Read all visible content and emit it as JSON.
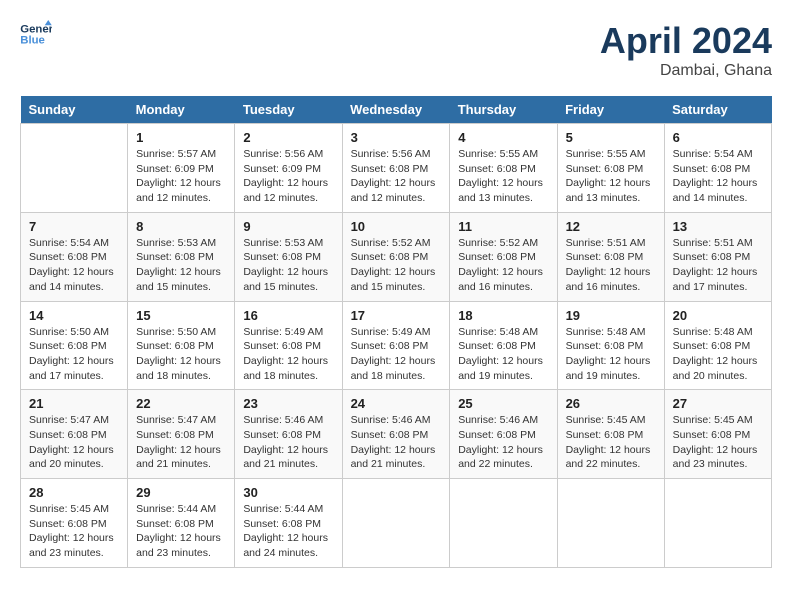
{
  "header": {
    "logo_line1": "General",
    "logo_line2": "Blue",
    "month": "April 2024",
    "location": "Dambai, Ghana"
  },
  "weekdays": [
    "Sunday",
    "Monday",
    "Tuesday",
    "Wednesday",
    "Thursday",
    "Friday",
    "Saturday"
  ],
  "weeks": [
    [
      {
        "day": "",
        "info": ""
      },
      {
        "day": "1",
        "info": "Sunrise: 5:57 AM\nSunset: 6:09 PM\nDaylight: 12 hours\nand 12 minutes."
      },
      {
        "day": "2",
        "info": "Sunrise: 5:56 AM\nSunset: 6:09 PM\nDaylight: 12 hours\nand 12 minutes."
      },
      {
        "day": "3",
        "info": "Sunrise: 5:56 AM\nSunset: 6:08 PM\nDaylight: 12 hours\nand 12 minutes."
      },
      {
        "day": "4",
        "info": "Sunrise: 5:55 AM\nSunset: 6:08 PM\nDaylight: 12 hours\nand 13 minutes."
      },
      {
        "day": "5",
        "info": "Sunrise: 5:55 AM\nSunset: 6:08 PM\nDaylight: 12 hours\nand 13 minutes."
      },
      {
        "day": "6",
        "info": "Sunrise: 5:54 AM\nSunset: 6:08 PM\nDaylight: 12 hours\nand 14 minutes."
      }
    ],
    [
      {
        "day": "7",
        "info": "Sunrise: 5:54 AM\nSunset: 6:08 PM\nDaylight: 12 hours\nand 14 minutes."
      },
      {
        "day": "8",
        "info": "Sunrise: 5:53 AM\nSunset: 6:08 PM\nDaylight: 12 hours\nand 15 minutes."
      },
      {
        "day": "9",
        "info": "Sunrise: 5:53 AM\nSunset: 6:08 PM\nDaylight: 12 hours\nand 15 minutes."
      },
      {
        "day": "10",
        "info": "Sunrise: 5:52 AM\nSunset: 6:08 PM\nDaylight: 12 hours\nand 15 minutes."
      },
      {
        "day": "11",
        "info": "Sunrise: 5:52 AM\nSunset: 6:08 PM\nDaylight: 12 hours\nand 16 minutes."
      },
      {
        "day": "12",
        "info": "Sunrise: 5:51 AM\nSunset: 6:08 PM\nDaylight: 12 hours\nand 16 minutes."
      },
      {
        "day": "13",
        "info": "Sunrise: 5:51 AM\nSunset: 6:08 PM\nDaylight: 12 hours\nand 17 minutes."
      }
    ],
    [
      {
        "day": "14",
        "info": "Sunrise: 5:50 AM\nSunset: 6:08 PM\nDaylight: 12 hours\nand 17 minutes."
      },
      {
        "day": "15",
        "info": "Sunrise: 5:50 AM\nSunset: 6:08 PM\nDaylight: 12 hours\nand 18 minutes."
      },
      {
        "day": "16",
        "info": "Sunrise: 5:49 AM\nSunset: 6:08 PM\nDaylight: 12 hours\nand 18 minutes."
      },
      {
        "day": "17",
        "info": "Sunrise: 5:49 AM\nSunset: 6:08 PM\nDaylight: 12 hours\nand 18 minutes."
      },
      {
        "day": "18",
        "info": "Sunrise: 5:48 AM\nSunset: 6:08 PM\nDaylight: 12 hours\nand 19 minutes."
      },
      {
        "day": "19",
        "info": "Sunrise: 5:48 AM\nSunset: 6:08 PM\nDaylight: 12 hours\nand 19 minutes."
      },
      {
        "day": "20",
        "info": "Sunrise: 5:48 AM\nSunset: 6:08 PM\nDaylight: 12 hours\nand 20 minutes."
      }
    ],
    [
      {
        "day": "21",
        "info": "Sunrise: 5:47 AM\nSunset: 6:08 PM\nDaylight: 12 hours\nand 20 minutes."
      },
      {
        "day": "22",
        "info": "Sunrise: 5:47 AM\nSunset: 6:08 PM\nDaylight: 12 hours\nand 21 minutes."
      },
      {
        "day": "23",
        "info": "Sunrise: 5:46 AM\nSunset: 6:08 PM\nDaylight: 12 hours\nand 21 minutes."
      },
      {
        "day": "24",
        "info": "Sunrise: 5:46 AM\nSunset: 6:08 PM\nDaylight: 12 hours\nand 21 minutes."
      },
      {
        "day": "25",
        "info": "Sunrise: 5:46 AM\nSunset: 6:08 PM\nDaylight: 12 hours\nand 22 minutes."
      },
      {
        "day": "26",
        "info": "Sunrise: 5:45 AM\nSunset: 6:08 PM\nDaylight: 12 hours\nand 22 minutes."
      },
      {
        "day": "27",
        "info": "Sunrise: 5:45 AM\nSunset: 6:08 PM\nDaylight: 12 hours\nand 23 minutes."
      }
    ],
    [
      {
        "day": "28",
        "info": "Sunrise: 5:45 AM\nSunset: 6:08 PM\nDaylight: 12 hours\nand 23 minutes."
      },
      {
        "day": "29",
        "info": "Sunrise: 5:44 AM\nSunset: 6:08 PM\nDaylight: 12 hours\nand 23 minutes."
      },
      {
        "day": "30",
        "info": "Sunrise: 5:44 AM\nSunset: 6:08 PM\nDaylight: 12 hours\nand 24 minutes."
      },
      {
        "day": "",
        "info": ""
      },
      {
        "day": "",
        "info": ""
      },
      {
        "day": "",
        "info": ""
      },
      {
        "day": "",
        "info": ""
      }
    ]
  ]
}
